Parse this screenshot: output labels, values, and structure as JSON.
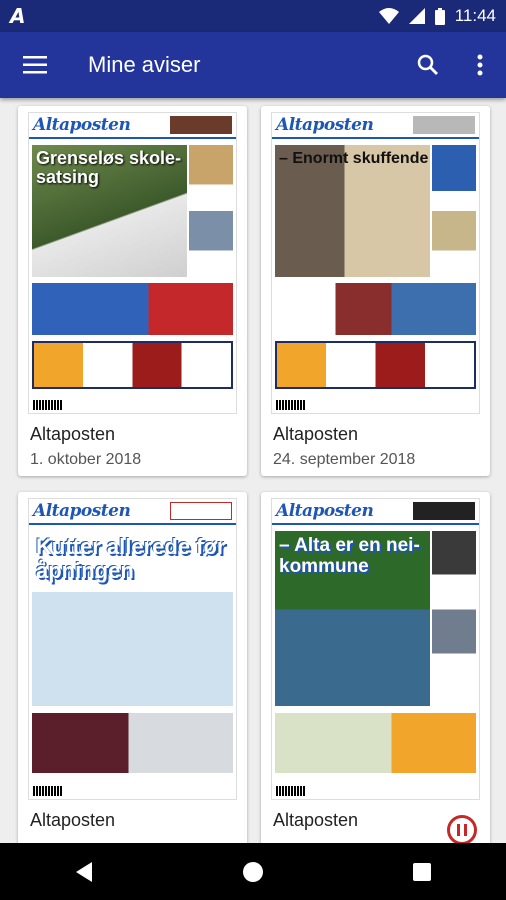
{
  "status_bar": {
    "carrier_logo": "A",
    "time": "11:44",
    "icons": [
      "wifi-icon",
      "signal-icon",
      "battery-icon"
    ]
  },
  "app_bar": {
    "title": "Mine aviser",
    "icons": [
      "menu-icon",
      "search-icon",
      "more-vert-icon"
    ]
  },
  "colors": {
    "app_bar": "#23349a",
    "status_bar": "#1a2a78",
    "brand_blue": "#1d56b5",
    "accent_red": "#c62828"
  },
  "newspapers": [
    {
      "name": "Altaposten",
      "date": "1. oktober 2018",
      "logo": "Altaposten",
      "headline": "Grenseløs skole-satsing"
    },
    {
      "name": "Altaposten",
      "date": "24. september 2018",
      "logo": "Altaposten",
      "headline": "– Enormt skuffende"
    },
    {
      "name": "Altaposten",
      "date": "",
      "logo": "Altaposten",
      "headline": "Kutter allerede før åpningen"
    },
    {
      "name": "Altaposten",
      "date": "",
      "logo": "Altaposten",
      "headline": "– Alta er en nei-kommune"
    }
  ],
  "nav_bar": {
    "icons": [
      "back-icon",
      "home-icon",
      "recents-icon"
    ]
  }
}
